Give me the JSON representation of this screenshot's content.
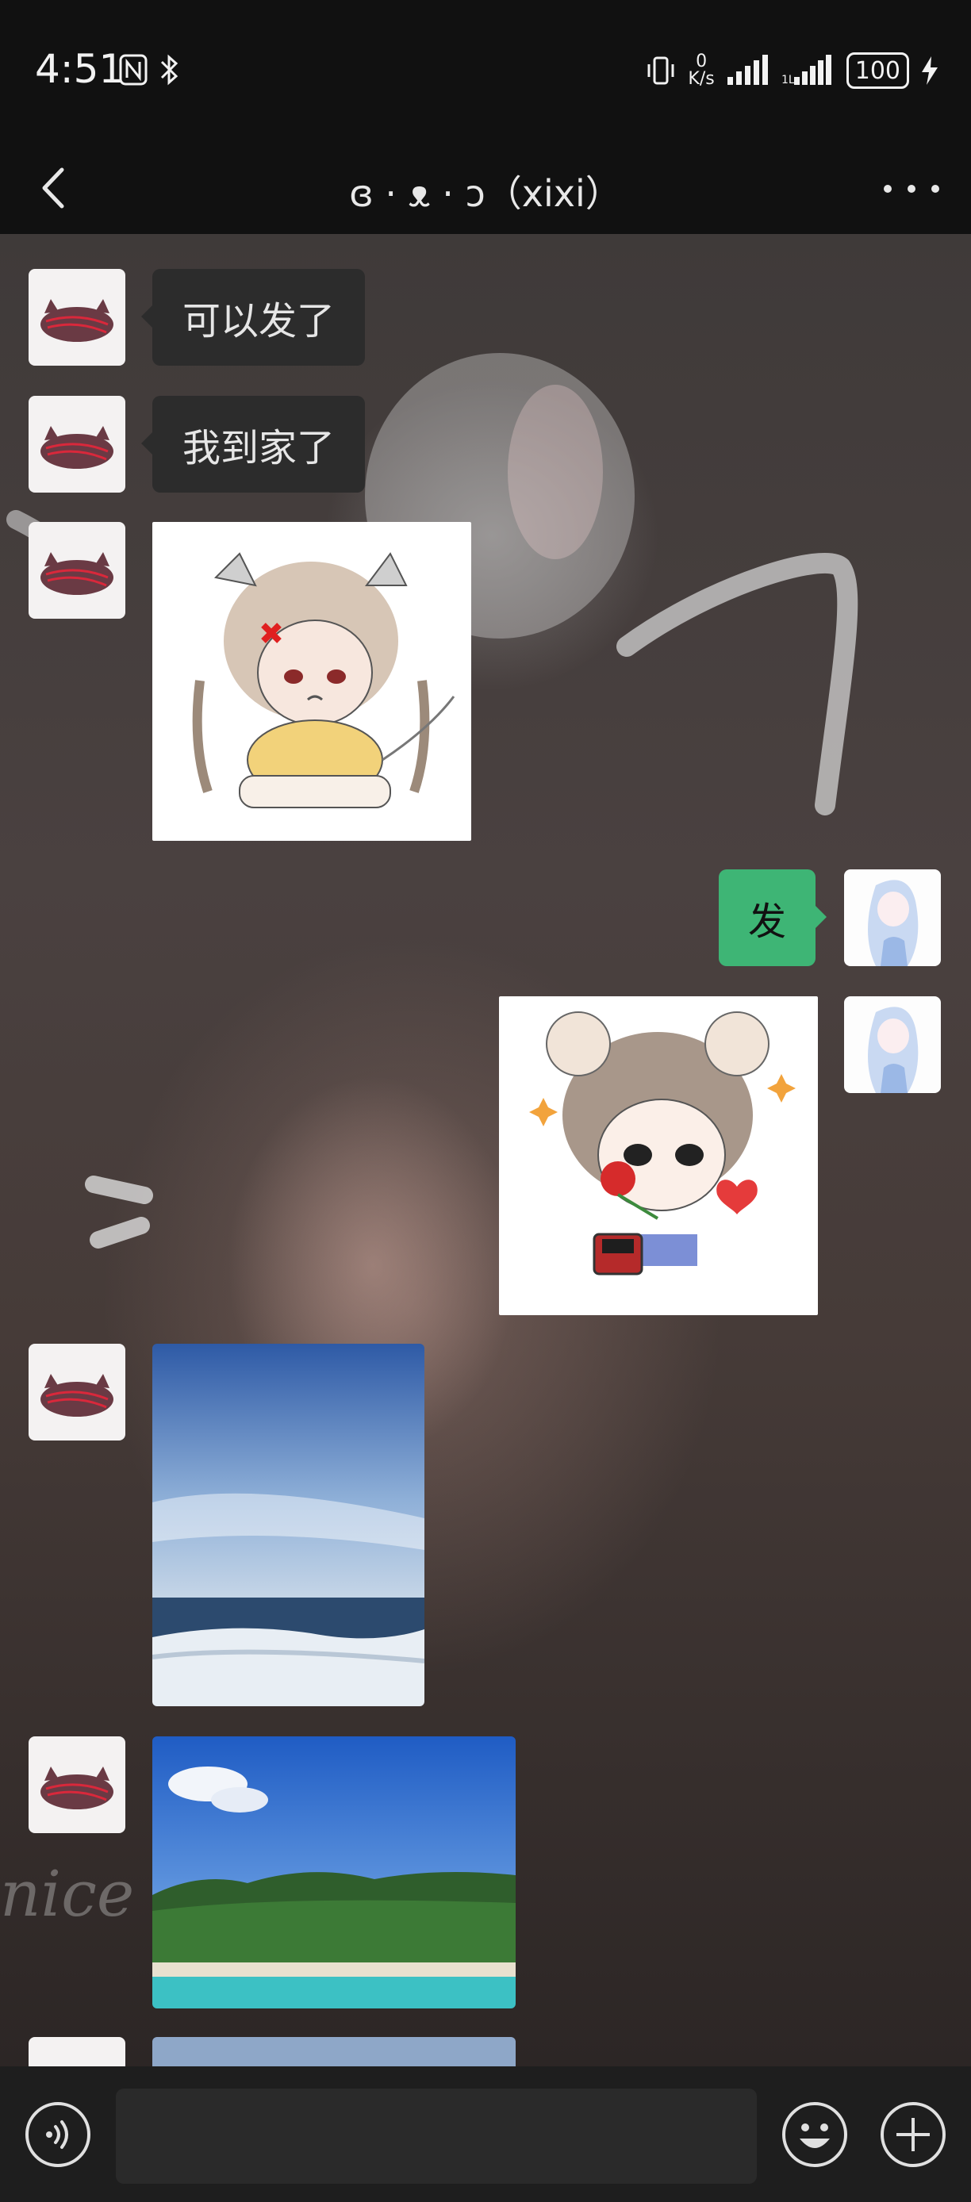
{
  "status_bar": {
    "time": "4:51",
    "net_speed_value": "0",
    "net_speed_unit": "K/s",
    "battery": "100"
  },
  "header": {
    "title": "ɞ · ᴥ · ɔ（xixi）"
  },
  "messages": [
    {
      "side": "left",
      "type": "text",
      "text": "可以发了"
    },
    {
      "side": "left",
      "type": "text",
      "text": "我到家了"
    },
    {
      "side": "left",
      "type": "sticker",
      "icon": "angry-chibi-sticker"
    },
    {
      "side": "right",
      "type": "text",
      "text": "发"
    },
    {
      "side": "right",
      "type": "sticker",
      "icon": "rose-ring-chibi-sticker"
    },
    {
      "side": "left",
      "type": "image",
      "icon": "ocean-sky-photo"
    },
    {
      "side": "left",
      "type": "image",
      "icon": "beach-island-photo"
    },
    {
      "side": "left",
      "type": "image",
      "icon": "partial-photo"
    }
  ],
  "input_bar": {
    "placeholder": "",
    "voice_icon": "voice-icon",
    "emoji_icon": "emoji-icon",
    "plus_icon": "plus-icon"
  },
  "colors": {
    "background": "#111111",
    "bubble_left": "#2c2c2c",
    "bubble_right": "#3eb575",
    "input_bar": "#1e1e1e"
  }
}
